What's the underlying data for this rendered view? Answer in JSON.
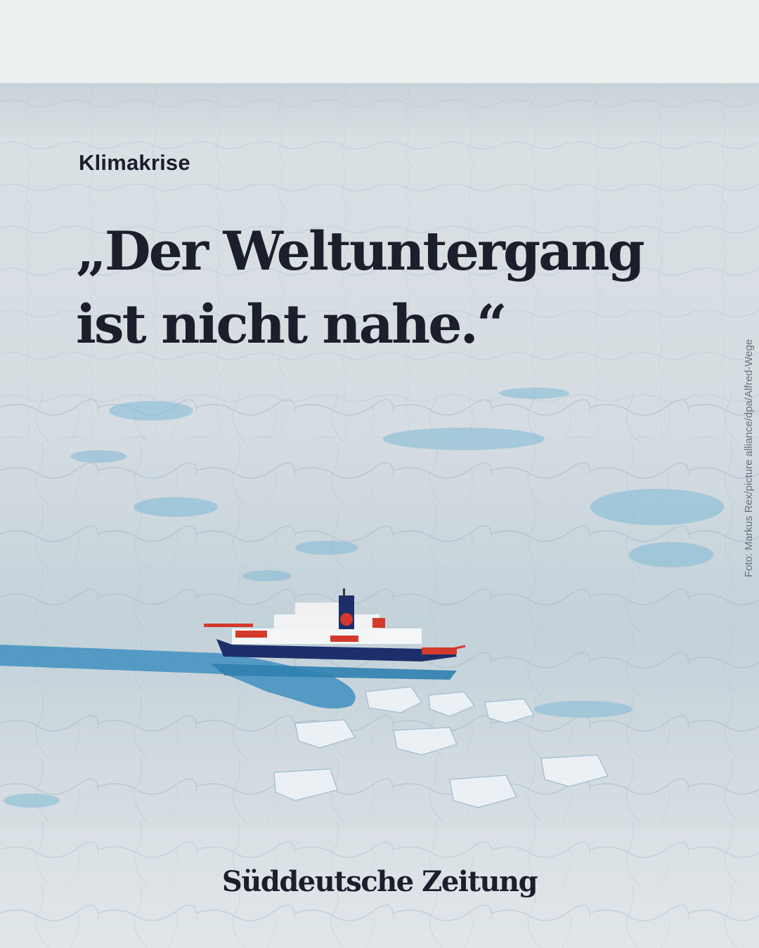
{
  "kicker": "Klimakrise",
  "headline": {
    "line1": "„Der Weltuntergang",
    "line2": "ist nicht nahe.“"
  },
  "photo_credit": "Foto: Markus Rex/picture alliance/dpa/Alfred-Wege",
  "logo": "Süddeutsche Zeitung",
  "colors": {
    "text": "#1c1f2b",
    "ice": "#e4e9ec",
    "water": "#5aa8cf",
    "ship_hull": "#1d2f6b",
    "ship_red": "#d33a2c"
  }
}
